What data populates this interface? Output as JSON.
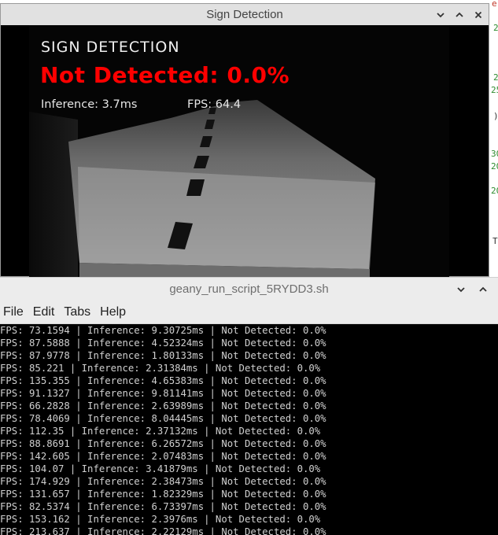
{
  "sign_window": {
    "title": "Sign Detection",
    "overlay": {
      "heading": "SIGN DETECTION",
      "status": "Not Detected: 0.0%",
      "inference": "Inference: 3.7ms",
      "fps": "FPS: 64.4"
    },
    "colors": {
      "status": "#ff0000",
      "overlay_text": "#f0f0f0"
    }
  },
  "terminal_window": {
    "title": "geany_run_script_5RYDD3.sh",
    "menu": [
      "File",
      "Edit",
      "Tabs",
      "Help"
    ],
    "lines": [
      "FPS: 73.1594 | Inference: 9.30725ms | Not Detected: 0.0%",
      "FPS: 87.5888 | Inference: 4.52324ms | Not Detected: 0.0%",
      "FPS: 87.9778 | Inference: 1.80133ms | Not Detected: 0.0%",
      "FPS: 85.221 | Inference: 2.31384ms | Not Detected: 0.0%",
      "FPS: 135.355 | Inference: 4.65383ms | Not Detected: 0.0%",
      "FPS: 91.1327 | Inference: 9.81141ms | Not Detected: 0.0%",
      "FPS: 66.2828 | Inference: 2.63989ms | Not Detected: 0.0%",
      "FPS: 78.4069 | Inference: 8.04445ms | Not Detected: 0.0%",
      "FPS: 112.35 | Inference: 2.37132ms | Not Detected: 0.0%",
      "FPS: 88.8691 | Inference: 6.26572ms | Not Detected: 0.0%",
      "FPS: 142.605 | Inference: 2.07483ms | Not Detected: 0.0%",
      "FPS: 104.07 | Inference: 3.41879ms | Not Detected: 0.0%",
      "FPS: 174.929 | Inference: 2.38473ms | Not Detected: 0.0%",
      "FPS: 131.657 | Inference: 1.82329ms | Not Detected: 0.0%",
      "FPS: 82.5374 | Inference: 6.73397ms | Not Detected: 0.0%",
      "FPS: 153.162 | Inference: 2.3976ms | Not Detected: 0.0%",
      "FPS: 213.637 | Inference: 2.22129ms | Not Detected: 0.0%"
    ]
  },
  "background_editor": {
    "fragments": [
      "e",
      "2",
      "2",
      "25",
      ")",
      "30",
      "20",
      "20",
      "TI"
    ]
  }
}
